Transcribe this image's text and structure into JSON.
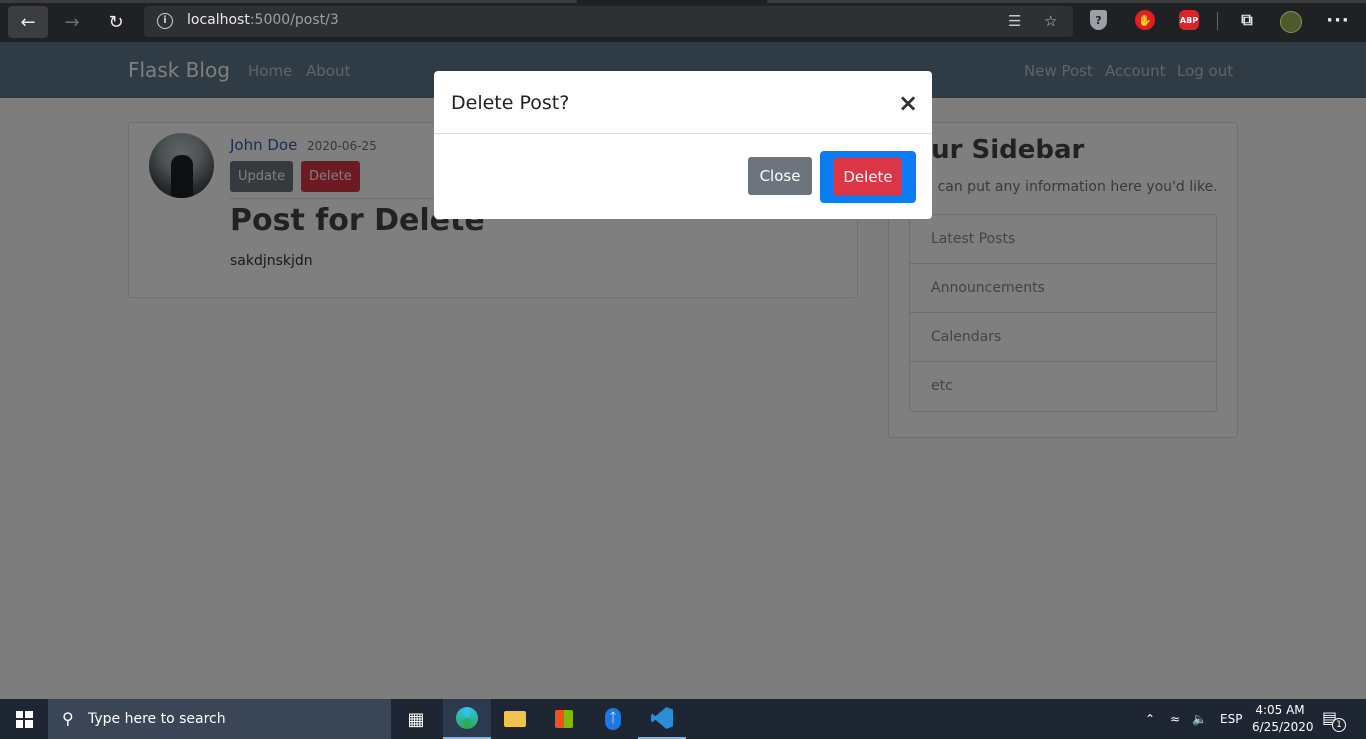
{
  "browser": {
    "url_host": "localhost",
    "url_port_path": ":5000/post/3",
    "icons": {
      "back": "back-arrow-icon",
      "forward": "forward-arrow-icon",
      "reload": "reload-icon",
      "info": "info-icon",
      "read_aloud": "read-aloud-icon",
      "favorite": "star-icon",
      "shield": "shield-extension-icon",
      "stop": "stop-extension-icon",
      "abp": "adblock-plus-icon",
      "collections": "collections-icon",
      "profile": "profile-avatar-icon",
      "more": "more-icon"
    },
    "abp_label": "ABP",
    "info_glyph": "i",
    "more_glyph": "···"
  },
  "navbar": {
    "brand": "Flask Blog",
    "links_left": [
      "Home",
      "About"
    ],
    "links_right": [
      "New Post",
      "Account",
      "Log out"
    ],
    "bg_color": "#5f788a"
  },
  "post": {
    "author": "John Doe",
    "date": "2020-06-25",
    "update_label": "Update",
    "delete_label": "Delete",
    "title": "Post for Delete",
    "body": "sakdjnskjdn"
  },
  "sidebar": {
    "title": "Our Sidebar",
    "subtitle": "You can put any information here you'd like.",
    "items": [
      "Latest Posts",
      "Announcements",
      "Calendars",
      "etc"
    ]
  },
  "modal": {
    "title": "Delete Post?",
    "close_glyph": "×",
    "close_label": "Close",
    "delete_label": "Delete",
    "danger_color": "#dc3545",
    "secondary_color": "#6c757d",
    "focus_color": "#0b7cf2"
  },
  "taskbar": {
    "search_placeholder": "Type here to search",
    "language": "ESP",
    "time": "4:05 AM",
    "date": "6/25/2020",
    "notification_count": "1",
    "apps": [
      "task-view-icon",
      "edge-icon",
      "file-explorer-icon",
      "store-icon",
      "bluetooth-icon",
      "vscode-icon"
    ]
  }
}
